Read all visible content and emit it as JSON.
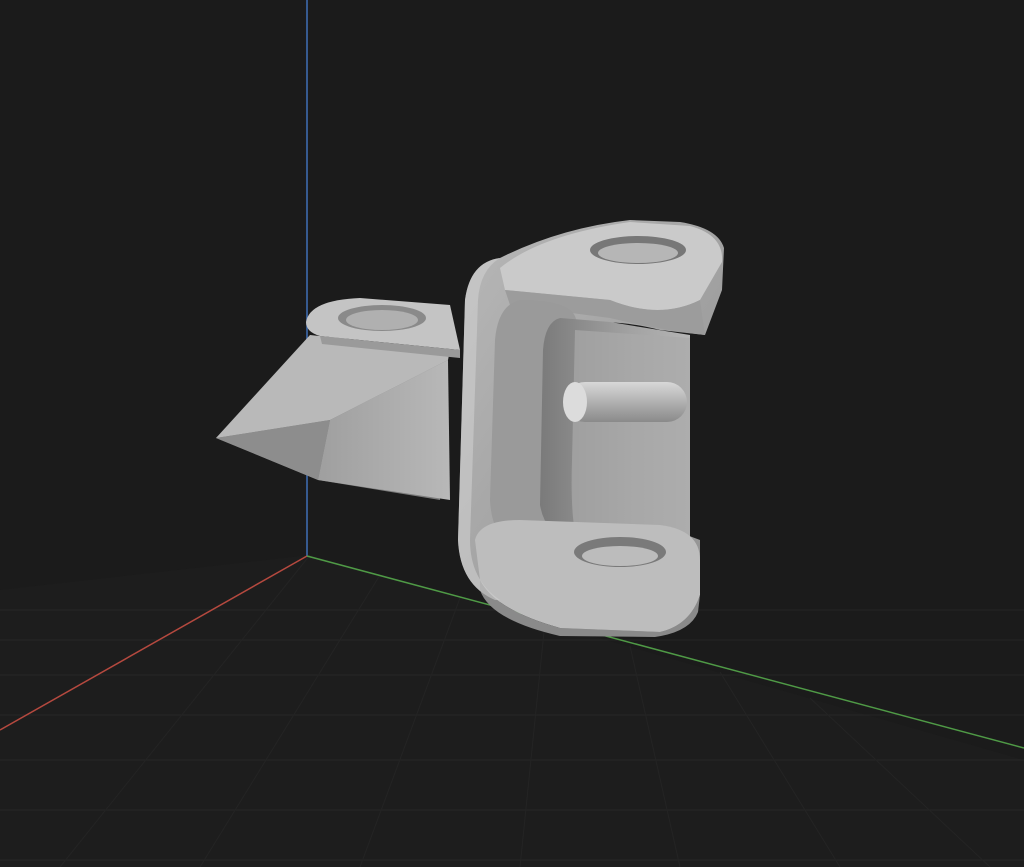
{
  "viewport": {
    "background": "#1b1b1b",
    "grid": {
      "visible": true,
      "minor_color": "#242424",
      "major_color": "#2c2c2c"
    },
    "axes": {
      "x_color": "#b5493f",
      "y_color": "#4f9a46",
      "z_color": "#3f6fb8"
    },
    "model": {
      "shade_light": "#c9c9c9",
      "shade_mid": "#a6a6a6",
      "shade_dark": "#808080",
      "shade_deep": "#676767"
    }
  }
}
